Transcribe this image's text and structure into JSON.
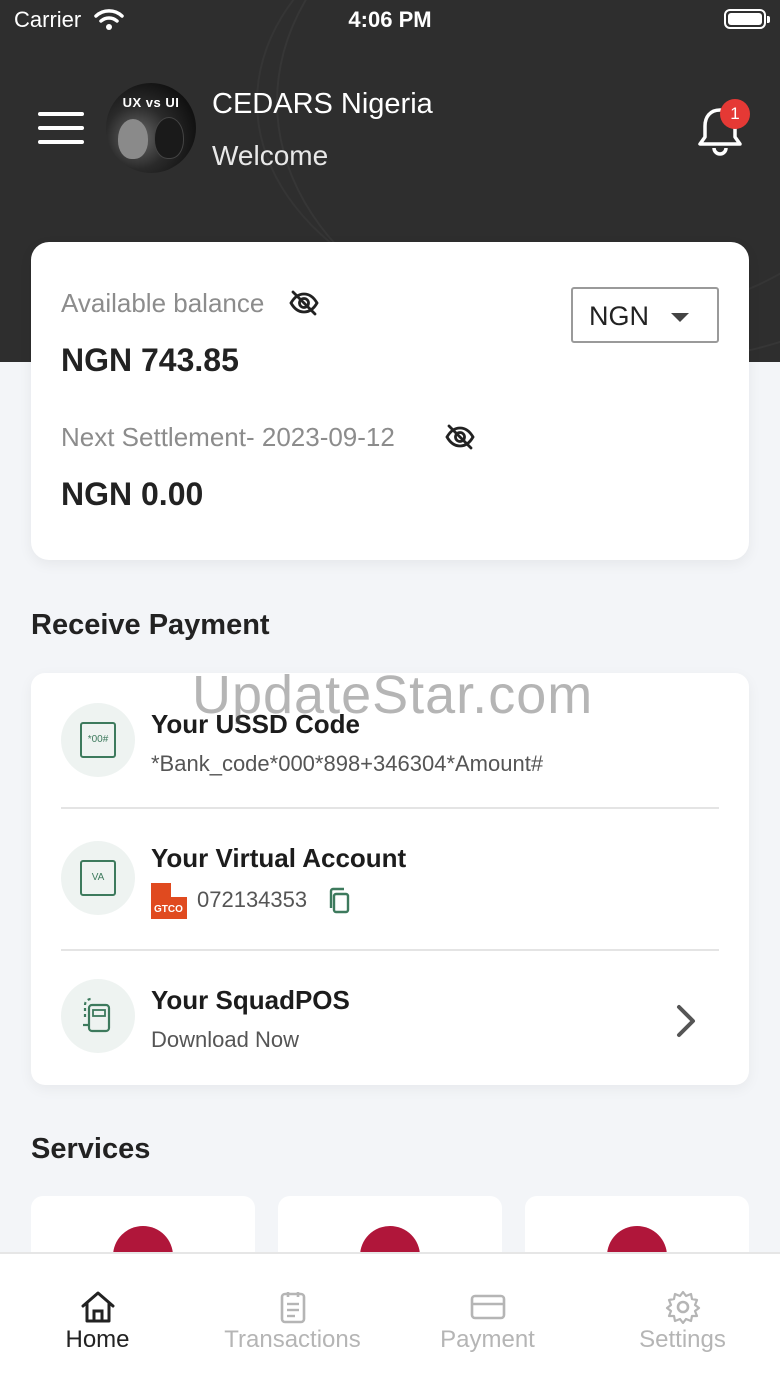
{
  "status_bar": {
    "carrier": "Carrier",
    "time": "4:06 PM"
  },
  "header": {
    "avatar_text": "UX vs UI",
    "org_name": "CEDARS Nigeria",
    "welcome": "Welcome",
    "notification_count": "1"
  },
  "balance": {
    "available_label": "Available balance",
    "available_value": "NGN 743.85",
    "currency": "NGN",
    "next_label": "Next Settlement- 2023-09-12",
    "next_value": "NGN 0.00"
  },
  "receive_payment": {
    "title": "Receive Payment",
    "ussd": {
      "icon_text": "*00#",
      "title": "Your USSD Code",
      "code": "*Bank_code*000*898+346304*Amount#"
    },
    "virtual_account": {
      "icon_text": "VA",
      "title": "Your Virtual Account",
      "bank_logo": "GTCO",
      "account_number": "072134353"
    },
    "squadpos": {
      "title": "Your SquadPOS",
      "subtitle": "Download Now"
    }
  },
  "watermark": "UpdateStar.com",
  "services": {
    "title": "Services"
  },
  "tabs": [
    {
      "label": "Home",
      "icon": "home-icon",
      "active": true
    },
    {
      "label": "Transactions",
      "icon": "clipboard-icon",
      "active": false
    },
    {
      "label": "Payment",
      "icon": "card-icon",
      "active": false
    },
    {
      "label": "Settings",
      "icon": "gear-icon",
      "active": false
    }
  ],
  "colors": {
    "header_bg": "#2e2e2e",
    "accent_green": "#3d7a5d",
    "badge_red": "#e53935",
    "service_red": "#b0163a",
    "bank_orange": "#e04a1f"
  }
}
